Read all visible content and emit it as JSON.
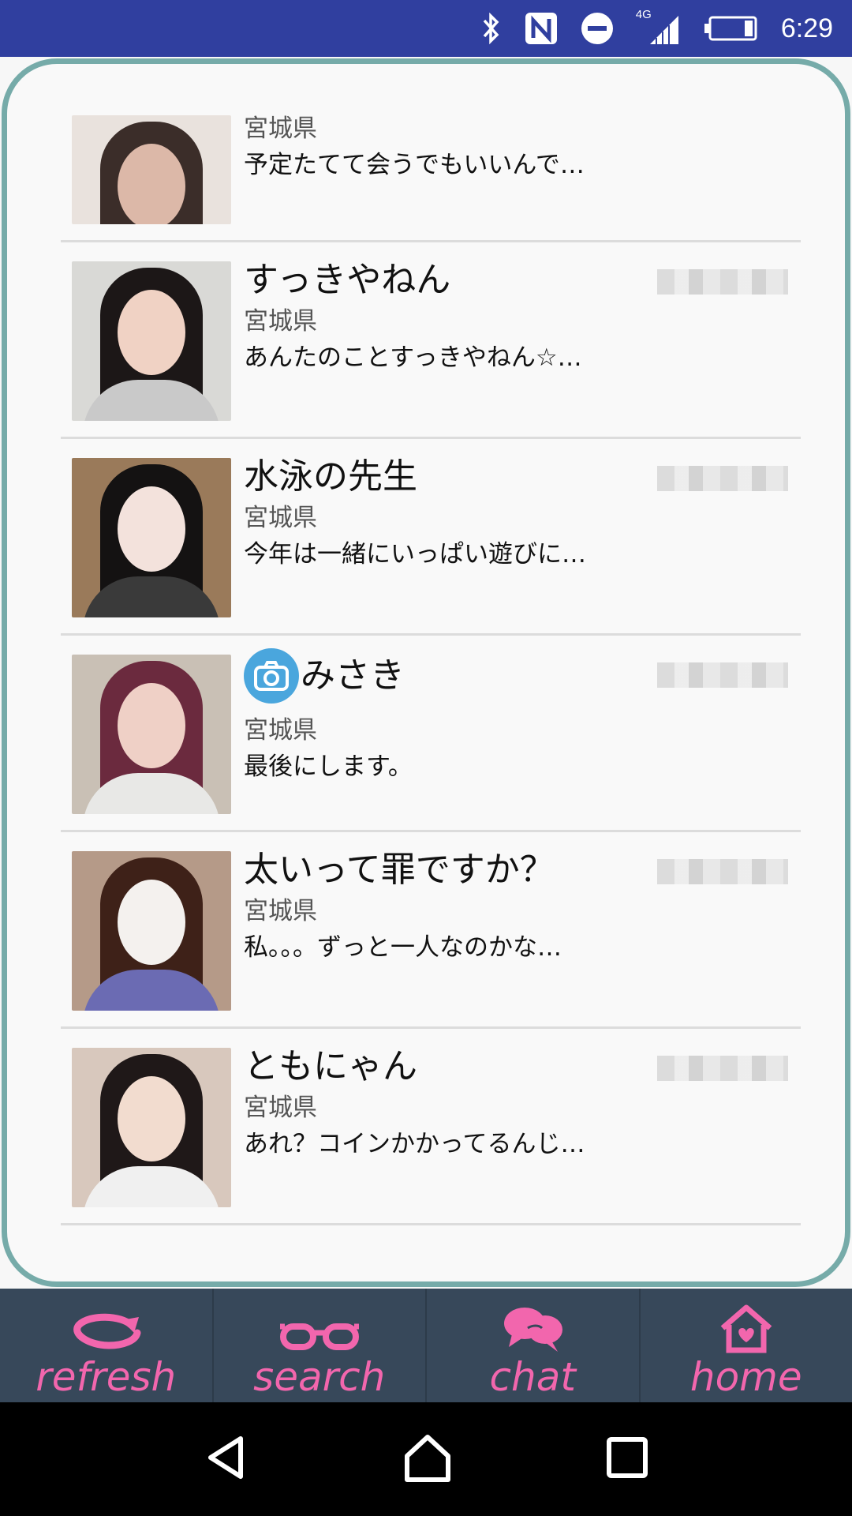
{
  "status_bar": {
    "network": "4G",
    "time": "6:29"
  },
  "users": [
    {
      "name": "",
      "prefecture": "宮城県",
      "message": "予定たてて会うでもいいんで…",
      "has_photo_badge": false,
      "avatar_colors": {
        "bg": "#e9e2dd",
        "hair": "#3b2d29",
        "face": "#dcb8a8",
        "shirt": "#2a2a2a"
      }
    },
    {
      "name": "すっきやねん",
      "prefecture": "宮城県",
      "message": "あんたのことすっきやねん☆…",
      "has_photo_badge": false,
      "avatar_colors": {
        "bg": "#d9d9d6",
        "hair": "#1c1717",
        "face": "#f0d2c4",
        "shirt": "#c9c9c9"
      }
    },
    {
      "name": "水泳の先生",
      "prefecture": "宮城県",
      "message": "今年は一緒にいっぱい遊びに…",
      "has_photo_badge": false,
      "avatar_colors": {
        "bg": "#9a7a5a",
        "hair": "#141212",
        "face": "#f3e2dc",
        "shirt": "#3a3a3a"
      }
    },
    {
      "name": "みさき",
      "prefecture": "宮城県",
      "message": "最後にします。",
      "has_photo_badge": true,
      "avatar_colors": {
        "bg": "#c9c0b5",
        "hair": "#6b2a3e",
        "face": "#efd0c6",
        "shirt": "#e8e8e6"
      }
    },
    {
      "name": "太いって罪ですか？",
      "prefecture": "宮城県",
      "message": "私。。。ずっと一人なのかな…",
      "has_photo_badge": false,
      "avatar_colors": {
        "bg": "#b59a88",
        "hair": "#3e2118",
        "face": "#f4f1ee",
        "shirt": "#6b6bb3"
      }
    },
    {
      "name": "ともにゃん",
      "prefecture": "宮城県",
      "message": "あれ？コインかかってるんじ…",
      "has_photo_badge": false,
      "avatar_colors": {
        "bg": "#d8c8bd",
        "hair": "#1f1818",
        "face": "#f2dccf",
        "shirt": "#f0f0f0"
      }
    }
  ],
  "bottom_nav": [
    {
      "label": "refresh",
      "icon": "refresh-icon"
    },
    {
      "label": "search",
      "icon": "glasses-icon"
    },
    {
      "label": "chat",
      "icon": "chat-bubbles-icon"
    },
    {
      "label": "home",
      "icon": "home-heart-icon"
    }
  ],
  "colors": {
    "status_bar": "#303f9f",
    "card_border": "#76aba9",
    "nav_bg": "#37485a",
    "nav_accent": "#f266ad"
  }
}
